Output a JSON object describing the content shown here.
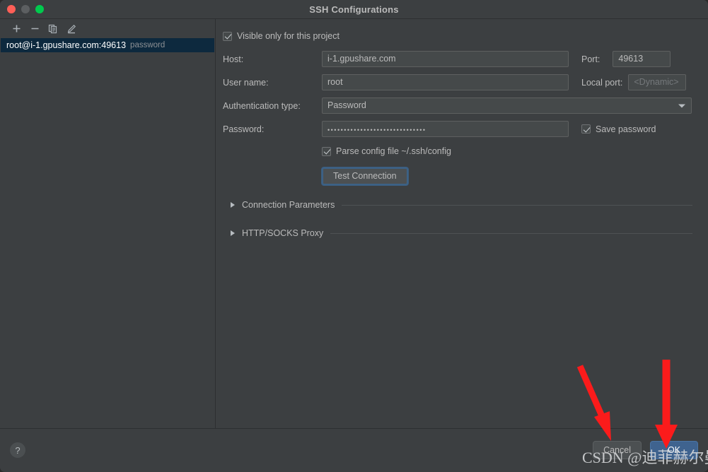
{
  "window": {
    "title": "SSH Configurations",
    "traffic_lights": [
      "close-button",
      "minimize-button",
      "maximize-button"
    ]
  },
  "sidebar": {
    "toolbar": [
      {
        "name": "add-icon",
        "label": "+"
      },
      {
        "name": "remove-icon",
        "label": "−"
      },
      {
        "name": "copy-icon",
        "label": "Duplicate"
      },
      {
        "name": "edit-pencil-icon",
        "label": "Edit"
      }
    ],
    "items": [
      {
        "label": "root@i-1.gpushare.com:49613",
        "suffix": "password",
        "selected": true
      }
    ]
  },
  "form": {
    "visible_only_checkbox": {
      "label": "Visible only for this project",
      "checked": true
    },
    "host": {
      "label": "Host:",
      "value": "i-1.gpushare.com"
    },
    "port": {
      "label": "Port:",
      "value": "49613"
    },
    "user_name": {
      "label": "User name:",
      "value": "root"
    },
    "local_port": {
      "label": "Local port:",
      "value": "",
      "placeholder": "<Dynamic>"
    },
    "auth_type": {
      "label": "Authentication type:",
      "value": "Password"
    },
    "password": {
      "label": "Password:",
      "value": "••••••••••••••••••••••••••••••"
    },
    "save_password_checkbox": {
      "label": "Save password",
      "checked": true
    },
    "parse_config_checkbox": {
      "label": "Parse config file ~/.ssh/config",
      "checked": true
    },
    "test_connection_button": "Test Connection",
    "sections": [
      {
        "title": "Connection Parameters",
        "expanded": false
      },
      {
        "title": "HTTP/SOCKS Proxy",
        "expanded": false
      }
    ]
  },
  "footer": {
    "help_label": "?",
    "cancel_label": "Cancel",
    "ok_label": "OK"
  },
  "annotations": {
    "watermark": "CSDN @迪菲赫尔曼",
    "arrow_color": "#fb1b1b",
    "arrows": [
      {
        "name": "arrow-to-cancel-button"
      },
      {
        "name": "arrow-to-ok-button"
      }
    ]
  },
  "colors": {
    "window_bg": "#3c3f41",
    "field_bg": "#45494a",
    "selection_bg": "#0d293e",
    "primary_button": "#3f638f",
    "text": "#bbbbbb"
  }
}
